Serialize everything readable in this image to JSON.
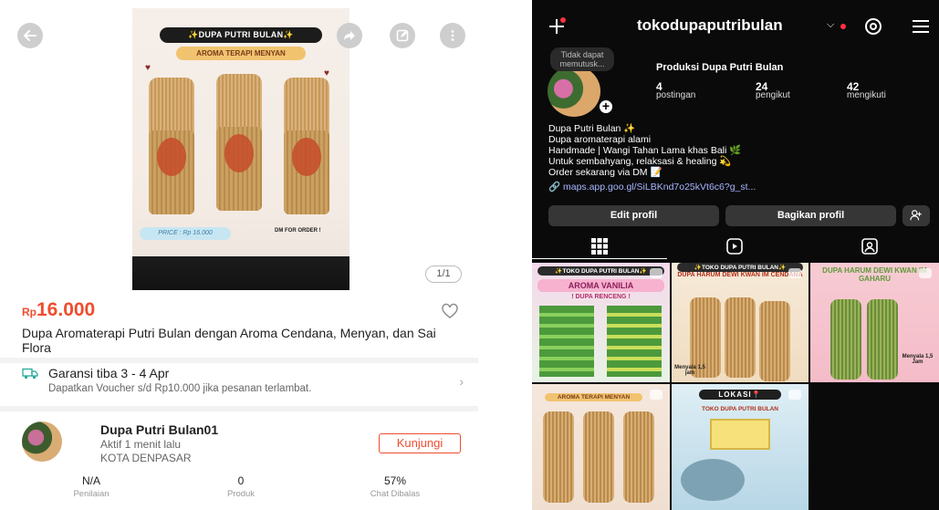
{
  "shop": {
    "image_counter": "1/1",
    "hero": {
      "banner": "✨DUPA PUTRI BULAN✨",
      "subtitle": "AROMA TERAPI MENYAN",
      "price_tag": "PRICE : Rp 16.000",
      "cta": "DM FOR ORDER !"
    },
    "price_currency": "Rp",
    "price_value": "16.000",
    "title": "Dupa Aromaterapi Putri Bulan dengan Aroma Cendana, Menyan, dan Sai Flora",
    "shipping": {
      "title": "Garansi tiba 3 - 4 Apr",
      "subtitle": "Dapatkan Voucher s/d Rp10.000 jika pesanan terlambat."
    },
    "store": {
      "name": "Dupa Putri Bulan01",
      "active": "Aktif 1 menit lalu",
      "city": "KOTA DENPASAR",
      "visit_label": "Kunjungi"
    },
    "stats": [
      {
        "value": "N/A",
        "label": "Penilaian"
      },
      {
        "value": "0",
        "label": "Produk"
      },
      {
        "value": "57%",
        "label": "Chat Dibalas"
      }
    ],
    "colors": {
      "accent": "#ee4d2d",
      "shipping_icon": "#26aa99"
    }
  },
  "ig": {
    "username": "tokodupaputribulan",
    "note": "Tidak dapat memutusk...",
    "display_name": "Produksi Dupa Putri Bulan",
    "counts": [
      {
        "value": "4",
        "label": "postingan"
      },
      {
        "value": "24",
        "label": "pengikut"
      },
      {
        "value": "42",
        "label": "mengikuti"
      }
    ],
    "bio": [
      "Dupa Putri Bulan ✨",
      "Dupa aromaterapi alami",
      "Handmade | Wangi Tahan Lama khas Bali 🌿",
      "Untuk sembahyang, relaksasi & healing 💫",
      "Order sekarang via DM 📝"
    ],
    "link": "maps.app.goo.gl/SiLBKnd7o25kVt6c6?g_st...",
    "edit_label": "Edit profil",
    "share_label": "Bagikan profil",
    "posts": [
      {
        "caption": "✨TOKO DUPA PUTRI BULAN✨",
        "caption2": "AROMA VANILIA",
        "caption3": "! DUPA RENCENG !"
      },
      {
        "caption": "✨TOKO DUPA PUTRI BULAN✨",
        "caption2": "DUPA HARUM DEWI KWAN IM CENDANA",
        "caption3": "Menyala 1,5 jam"
      },
      {
        "caption": "DUPA HARUM DEWI KWAN IM GAHARU",
        "caption2": "Menyala 1,5 Jam",
        "caption3": ""
      },
      {
        "caption": "AROMA TERAPI MENYAN",
        "caption2": "",
        "caption3": ""
      },
      {
        "caption": "LOKASI📍",
        "caption2": "TOKO DUPA PUTRI BULAN",
        "caption3": ""
      }
    ],
    "colors": {
      "background": "#0a0a0a",
      "button": "#363636",
      "link": "#a8b6ff",
      "notification": "#ff3040"
    }
  }
}
